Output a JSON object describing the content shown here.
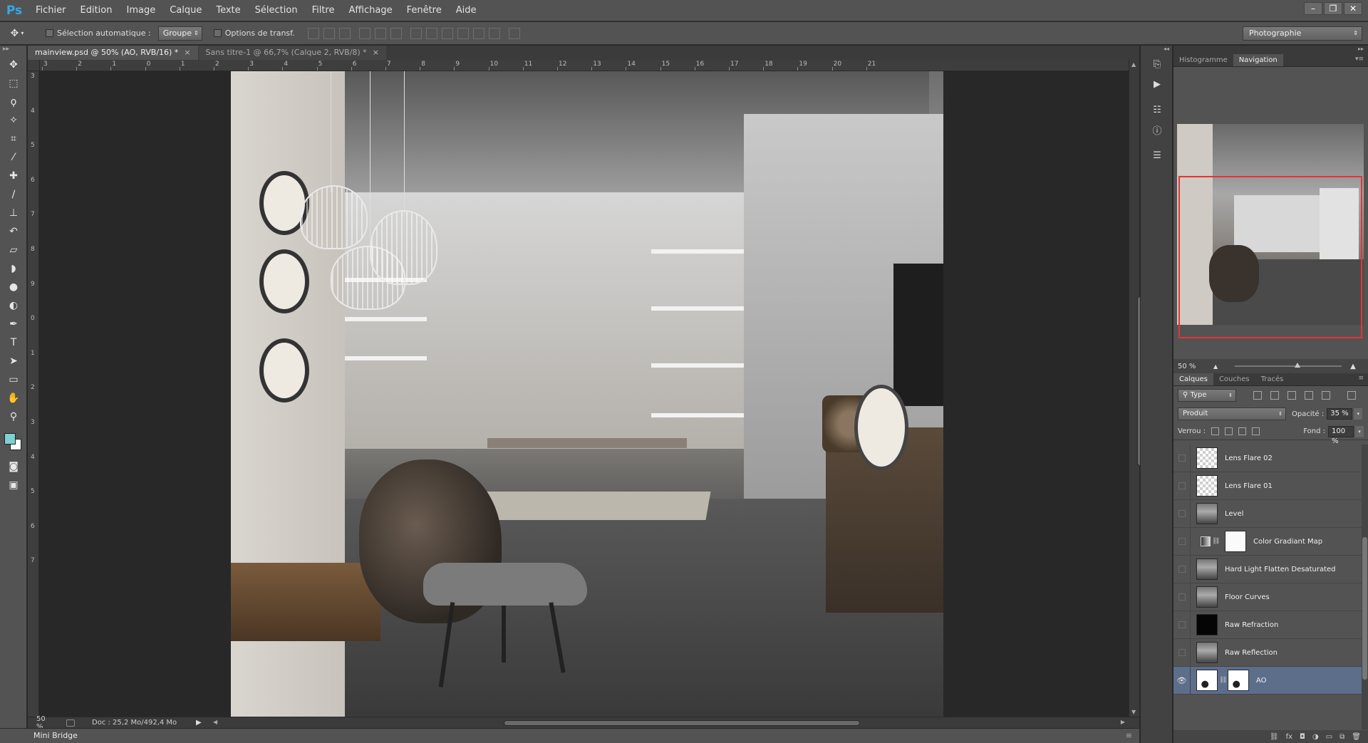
{
  "app": {
    "logo": "Ps",
    "menu": [
      "Fichier",
      "Edition",
      "Image",
      "Calque",
      "Texte",
      "Sélection",
      "Filtre",
      "Affichage",
      "Fenêtre",
      "Aide"
    ],
    "window_controls": [
      "–",
      "❐",
      "✕"
    ]
  },
  "options_bar": {
    "auto_select_label": "Sélection automatique :",
    "auto_select_value": "Groupe",
    "transform_label": "Options de transf.",
    "workspace": "Photographie"
  },
  "tools": [
    {
      "icon": "move-tool-icon",
      "glyph": "✥"
    },
    {
      "icon": "marquee-tool-icon",
      "glyph": "⬚"
    },
    {
      "icon": "lasso-tool-icon",
      "glyph": "ϙ"
    },
    {
      "icon": "quick-select-tool-icon",
      "glyph": "✧"
    },
    {
      "icon": "crop-tool-icon",
      "glyph": "⌗"
    },
    {
      "icon": "eyedropper-tool-icon",
      "glyph": "⁄"
    },
    {
      "icon": "healing-brush-tool-icon",
      "glyph": "✚"
    },
    {
      "icon": "brush-tool-icon",
      "glyph": "∕"
    },
    {
      "icon": "stamp-tool-icon",
      "glyph": "⊥"
    },
    {
      "icon": "history-brush-tool-icon",
      "glyph": "↶"
    },
    {
      "icon": "eraser-tool-icon",
      "glyph": "▱"
    },
    {
      "icon": "paint-bucket-tool-icon",
      "glyph": "◗"
    },
    {
      "icon": "blur-tool-icon",
      "glyph": "●"
    },
    {
      "icon": "dodge-tool-icon",
      "glyph": "◐"
    },
    {
      "icon": "pen-tool-icon",
      "glyph": "✒"
    },
    {
      "icon": "type-tool-icon",
      "glyph": "T"
    },
    {
      "icon": "path-select-tool-icon",
      "glyph": "➤"
    },
    {
      "icon": "rectangle-tool-icon",
      "glyph": "▭"
    },
    {
      "icon": "hand-tool-icon",
      "glyph": "✋"
    },
    {
      "icon": "zoom-tool-icon",
      "glyph": "⚲"
    }
  ],
  "colors": {
    "foreground": "#7fd0d0",
    "background": "#ffffff",
    "accent_selection": "#5c6e8a",
    "nav_frame": "#e23535"
  },
  "document_tabs": [
    {
      "label": "mainview.psd @ 50% (AO, RVB/16) *",
      "active": true
    },
    {
      "label": "Sans titre-1 @ 66,7% (Calque 2, RVB/8) *",
      "active": false
    }
  ],
  "ruler_h": [
    "3",
    "2",
    "1",
    "0",
    "1",
    "2",
    "3",
    "4",
    "5",
    "6",
    "7",
    "8",
    "9",
    "10",
    "11",
    "12",
    "13",
    "14",
    "15",
    "16",
    "17",
    "18",
    "19",
    "20",
    "21"
  ],
  "ruler_v": [
    "3",
    "4",
    "5",
    "6",
    "7",
    "8",
    "9",
    "0",
    "1",
    "2",
    "3",
    "4",
    "5",
    "6",
    "7"
  ],
  "status": {
    "zoom": "50 %",
    "doc_info": "Doc : 25,2 Mo/492,4 Mo"
  },
  "mini_bridge": "Mini Bridge",
  "top_panel": {
    "tabs": [
      {
        "label": "Histogramme",
        "active": false
      },
      {
        "label": "Navigation",
        "active": true
      }
    ],
    "zoom": "50 %"
  },
  "layers_panel": {
    "tabs": [
      {
        "label": "Calques",
        "active": true
      },
      {
        "label": "Couches",
        "active": false
      },
      {
        "label": "Tracés",
        "active": false
      }
    ],
    "filter": "Type",
    "blend_mode": "Produit",
    "opacity_label": "Opacité :",
    "opacity": "35 %",
    "lock_label": "Verrou :",
    "fill_label": "Fond :",
    "fill": "100 %",
    "layers": [
      {
        "name": "Lens Flare 02",
        "thumb": "checker",
        "visible": false,
        "selected": false
      },
      {
        "name": "Lens Flare 01",
        "thumb": "checker",
        "visible": false,
        "selected": false
      },
      {
        "name": "Level",
        "thumb": "photo",
        "visible": false,
        "selected": false
      },
      {
        "name": "Color Gradiant Map",
        "thumb": "adjustment",
        "visible": false,
        "selected": false
      },
      {
        "name": "Hard Light Flatten Desaturated",
        "thumb": "photo",
        "visible": false,
        "selected": false
      },
      {
        "name": "Floor Curves",
        "thumb": "photo",
        "visible": false,
        "selected": false
      },
      {
        "name": "Raw Refraction",
        "thumb": "black",
        "visible": false,
        "selected": false
      },
      {
        "name": "Raw Reflection",
        "thumb": "photo",
        "visible": false,
        "selected": false
      },
      {
        "name": "AO",
        "thumb": "ao",
        "visible": true,
        "selected": true
      }
    ]
  }
}
